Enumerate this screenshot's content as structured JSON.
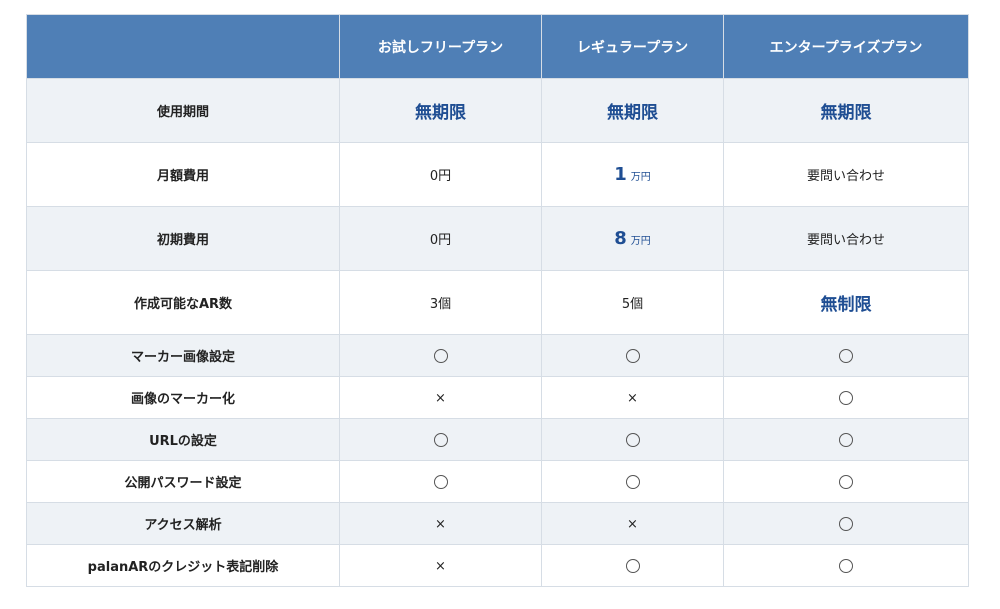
{
  "header": {
    "corner": "",
    "plans": [
      "お試しフリープラン",
      "レギュラープラン",
      "エンタープライズプラン"
    ]
  },
  "rows": [
    {
      "label": "使用期間",
      "cells": [
        {
          "type": "accent",
          "text": "無期限"
        },
        {
          "type": "accent",
          "text": "無期限"
        },
        {
          "type": "accent",
          "text": "無期限"
        }
      ]
    },
    {
      "label": "月額費用",
      "cells": [
        {
          "type": "plain",
          "text": "0円"
        },
        {
          "type": "price",
          "text": "1",
          "unit": "万円"
        },
        {
          "type": "plain",
          "text": "要問い合わせ"
        }
      ]
    },
    {
      "label": "初期費用",
      "cells": [
        {
          "type": "plain",
          "text": "0円"
        },
        {
          "type": "price",
          "text": "8",
          "unit": "万円"
        },
        {
          "type": "plain",
          "text": "要問い合わせ"
        }
      ]
    },
    {
      "label": "作成可能なAR数",
      "cells": [
        {
          "type": "plain",
          "text": "3個"
        },
        {
          "type": "plain",
          "text": "5個"
        },
        {
          "type": "accent",
          "text": "無制限"
        }
      ]
    },
    {
      "label": "マーカー画像設定",
      "cells": [
        {
          "type": "circle"
        },
        {
          "type": "circle"
        },
        {
          "type": "circle"
        }
      ]
    },
    {
      "label": "画像のマーカー化",
      "cells": [
        {
          "type": "cross",
          "text": "×"
        },
        {
          "type": "cross",
          "text": "×"
        },
        {
          "type": "circle"
        }
      ]
    },
    {
      "label": "URLの設定",
      "cells": [
        {
          "type": "circle"
        },
        {
          "type": "circle"
        },
        {
          "type": "circle"
        }
      ]
    },
    {
      "label": "公開パスワード設定",
      "cells": [
        {
          "type": "circle"
        },
        {
          "type": "circle"
        },
        {
          "type": "circle"
        }
      ]
    },
    {
      "label": "アクセス解析",
      "cells": [
        {
          "type": "cross",
          "text": "×"
        },
        {
          "type": "cross",
          "text": "×"
        },
        {
          "type": "circle"
        }
      ]
    },
    {
      "label": "palanARのクレジット表記削除",
      "cells": [
        {
          "type": "cross",
          "text": "×"
        },
        {
          "type": "circle"
        },
        {
          "type": "circle"
        }
      ]
    }
  ]
}
